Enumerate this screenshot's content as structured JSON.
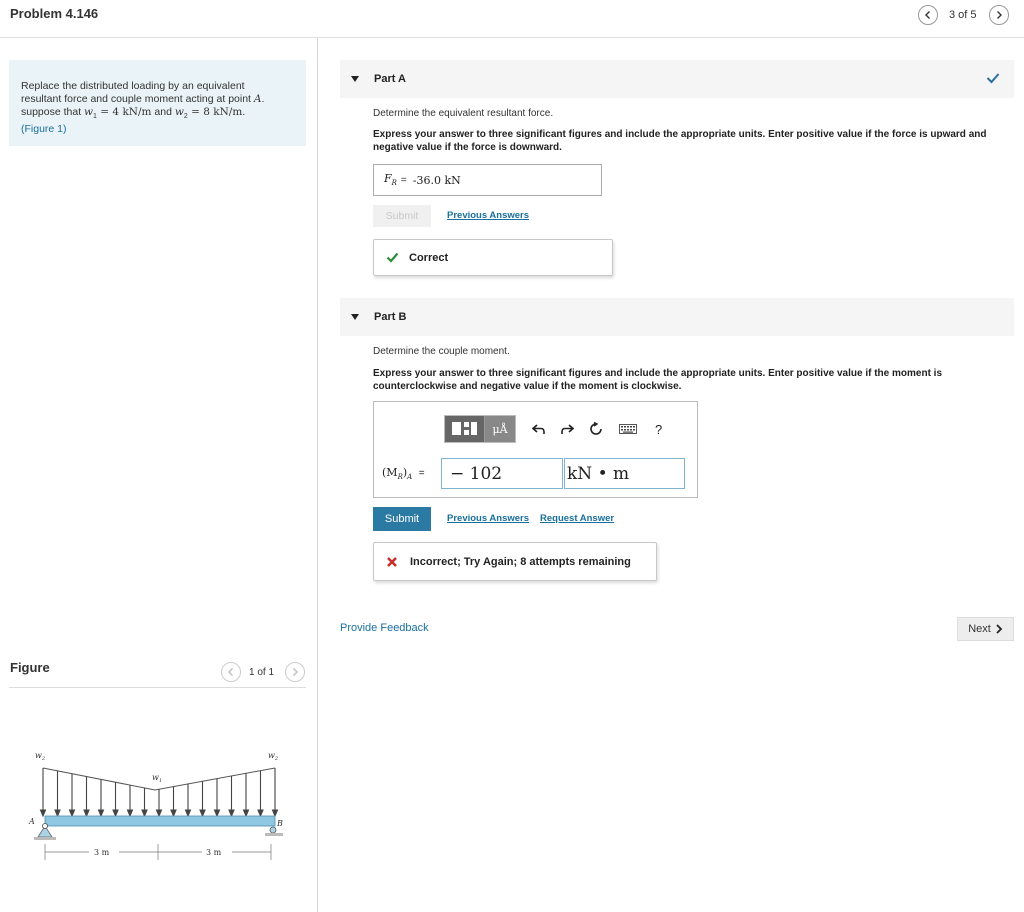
{
  "header": {
    "title": "Problem 4.146",
    "pager": "3 of 5"
  },
  "problem": {
    "line1": "Replace the distributed loading by an equivalent",
    "line2_text": "resultant force and couple moment acting at point ",
    "line2_point": "A",
    "line3_prefix": "suppose that ",
    "w1_sym": "w",
    "w1_sub": "1",
    "w1_val": " = 4  kN/m",
    "and_text": " and ",
    "w2_sym": "w",
    "w2_sub": "2",
    "w2_val": " = 8  kN/m",
    "period": ".",
    "figure_link": "(Figure 1)"
  },
  "figure": {
    "title": "Figure",
    "pager": "1 of 1",
    "labels": {
      "w2_left": "w",
      "w2_right": "w",
      "w1_mid": "w",
      "sub1": "1",
      "sub2": "2",
      "point_a": "A",
      "point_b": "B",
      "dim_left": "3 m",
      "dim_right": "3 m"
    }
  },
  "partA": {
    "label": "Part A",
    "prompt": "Determine the equivalent resultant force.",
    "instructions": "Express your answer to three significant figures and include the appropriate units. Enter positive value if the force is upward and negative value if the force is downward.",
    "symbol": "F",
    "symbol_sub": "R",
    "equals": "=",
    "answer": "-36.0 kN",
    "submit_label": "Submit",
    "previous_answers": "Previous Answers",
    "feedback": "Correct"
  },
  "partB": {
    "label": "Part B",
    "prompt": "Determine the couple moment.",
    "instructions": "Express your answer to three significant figures and include the appropriate units. Enter positive value if the moment is counterclockwise and negative value if the moment is clockwise.",
    "symbol_label": "(M",
    "symbol_sub": "R",
    "symbol_close": ")",
    "symbol_sub2": "A",
    "equals": "=",
    "value": "− 102",
    "units": "kN • m",
    "toolbar_mu": "μÅ",
    "toolbar_help": "?",
    "submit_label": "Submit",
    "previous_answers": "Previous Answers",
    "request_answer": "Request Answer",
    "feedback": "Incorrect; Try Again; 8 attempts remaining"
  },
  "footer": {
    "provide_feedback": "Provide Feedback",
    "next_label": "Next"
  },
  "colors": {
    "link": "#1a6f9e",
    "correct_green": "#2e8b3a",
    "incorrect_red": "#c8302c",
    "submit_blue": "#2b7aa3",
    "problem_bg": "#eaf4f8"
  }
}
